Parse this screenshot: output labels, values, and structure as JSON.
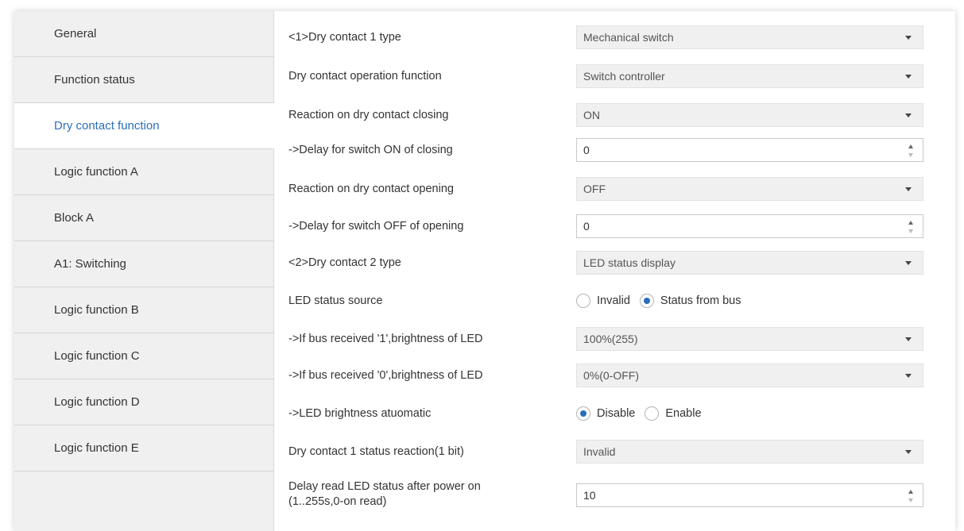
{
  "sidebar": {
    "items": [
      {
        "label": "General",
        "active": false
      },
      {
        "label": "Function status",
        "active": false
      },
      {
        "label": "Dry contact function",
        "active": true
      },
      {
        "label": "Logic function A",
        "active": false
      },
      {
        "label": "Block A",
        "active": false
      },
      {
        "label": "A1: Switching",
        "active": false
      },
      {
        "label": "Logic function B",
        "active": false
      },
      {
        "label": "Logic function C",
        "active": false
      },
      {
        "label": "Logic function D",
        "active": false
      },
      {
        "label": "Logic function E",
        "active": false
      }
    ]
  },
  "params": [
    {
      "label": "<1>Dry contact 1 type",
      "type": "select",
      "value": "Mechanical switch"
    },
    {
      "label": "Dry contact operation function",
      "type": "select",
      "value": "Switch controller"
    },
    {
      "label": "Reaction on dry contact closing",
      "type": "select",
      "value": "ON"
    },
    {
      "label": "->Delay for switch ON of closing",
      "type": "spin",
      "value": "0"
    },
    {
      "label": "Reaction on dry contact opening",
      "type": "select",
      "value": "OFF"
    },
    {
      "label": "->Delay for switch OFF of opening",
      "type": "spin",
      "value": "0"
    },
    {
      "label": "<2>Dry contact 2 type",
      "type": "select",
      "value": "LED status display"
    },
    {
      "label": "LED status source",
      "type": "radio",
      "options": [
        "Invalid",
        "Status from bus"
      ],
      "selected": 1
    },
    {
      "label": "->If bus received '1',brightness of LED",
      "type": "select",
      "value": "100%(255)"
    },
    {
      "label": "->If bus received '0',brightness of LED",
      "type": "select",
      "value": "0%(0-OFF)"
    },
    {
      "label": "->LED brightness atuomatic",
      "type": "radio",
      "options": [
        "Disable",
        "Enable"
      ],
      "selected": 0
    },
    {
      "label": "Dry contact 1 status reaction(1 bit)",
      "type": "select",
      "value": "Invalid"
    },
    {
      "label": "Delay read LED status after power on\n(1..255s,0-on read)",
      "type": "spin",
      "value": "10"
    }
  ],
  "colors": {
    "accent": "#2a6ebb",
    "sidebar_bg": "#f0f0f0",
    "select_bg": "#f0f0f0"
  },
  "icons": {
    "dropdown": "chevron-down-icon",
    "spinner": "spinner-arrows-icon"
  }
}
